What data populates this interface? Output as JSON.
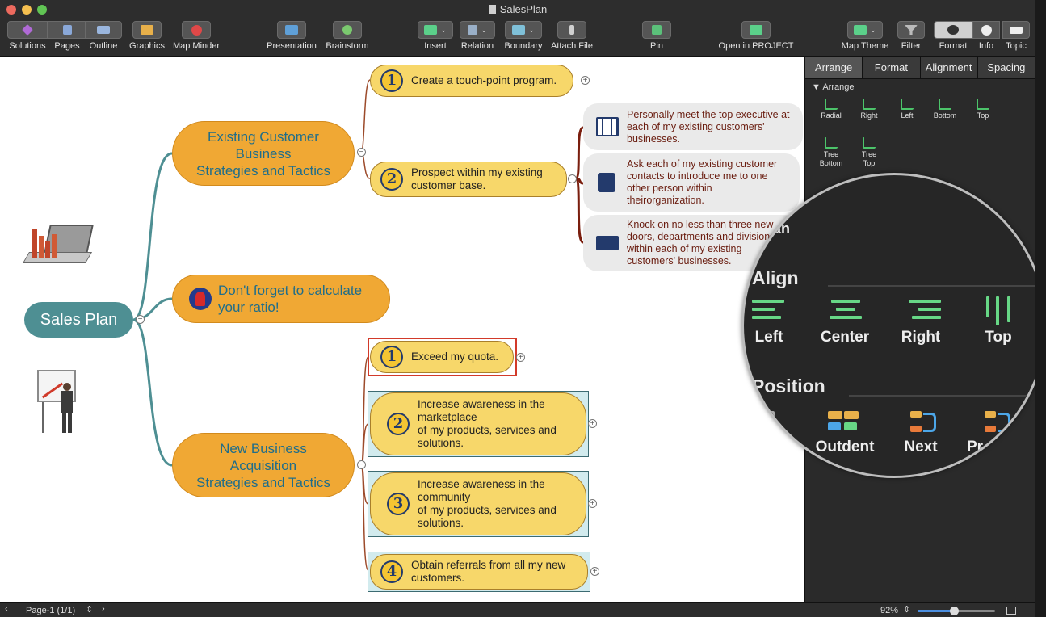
{
  "window": {
    "title": "SalesPlan"
  },
  "toolbar": {
    "left": [
      "Solutions",
      "Pages",
      "Outline",
      "Graphics",
      "Map Minder"
    ],
    "middle": [
      "Presentation",
      "Brainstorm",
      "Insert",
      "Relation",
      "Boundary",
      "Attach File",
      "Pin",
      "Open in PROJECT"
    ],
    "right": [
      "Map Theme",
      "Filter",
      "Format",
      "Info",
      "Topic"
    ]
  },
  "map": {
    "central": "Sales Plan",
    "branch1": [
      "Existing Customer",
      "Business",
      "Strategies and Tactics"
    ],
    "branch2": [
      "Don't forget to calculate",
      "your ratio!"
    ],
    "branch3": [
      "New Business",
      "Acquisition",
      "Strategies and Tactics"
    ],
    "topics": {
      "t1": {
        "num": "1",
        "lines": [
          "Create a touch-point program."
        ]
      },
      "t2": {
        "num": "2",
        "lines": [
          "Prospect within my existing",
          "customer base."
        ]
      },
      "t3": {
        "num": "1",
        "lines": [
          "Exceed my quota."
        ]
      },
      "t4": {
        "num": "2",
        "lines": [
          "Increase awareness in the",
          "marketplace",
          "of my products, services and",
          "solutions."
        ]
      },
      "t5": {
        "num": "3",
        "lines": [
          "Increase awareness in the",
          "community",
          "of my products, services and",
          "solutions."
        ]
      },
      "t6": {
        "num": "4",
        "lines": [
          "Obtain referrals from all my new",
          "customers."
        ]
      }
    },
    "notes": {
      "n1": [
        "Personally meet the top executive at",
        "each of my existing customers'",
        "businesses."
      ],
      "n2": [
        "Ask each of my existing customer",
        "contacts to introduce me to one",
        "other person within",
        "theirorganization."
      ],
      "n3": [
        "Knock on no less than three new",
        "doors, departments and divisions",
        "within each of my existing",
        "customers' businesses."
      ]
    }
  },
  "panel": {
    "tabs": [
      "Arrange",
      "Format",
      "Alignment",
      "Spacing"
    ],
    "section": "Arrange",
    "layouts": [
      {
        "label": [
          "Radial"
        ]
      },
      {
        "label": [
          "Right"
        ]
      },
      {
        "label": [
          "Left"
        ]
      },
      {
        "label": [
          "Bottom"
        ]
      },
      {
        "label": [
          "Top"
        ]
      },
      {
        "label": [
          "Tree",
          "Bottom"
        ]
      },
      {
        "label": [
          "Tree",
          "Top"
        ]
      }
    ]
  },
  "magnifier": {
    "partial": "an",
    "align_title": "Align",
    "align": [
      "Left",
      "Center",
      "Right",
      "Top"
    ],
    "position_title": "Position",
    "position": [
      "Outdent",
      "Next",
      "Pr"
    ]
  },
  "status": {
    "page": "Page-1 (1/1)",
    "zoom": "92%"
  },
  "colors": {
    "accent": "#4e8f93",
    "branch": "#f0a834",
    "topic": "#f7d76a",
    "green": "#67d786"
  }
}
